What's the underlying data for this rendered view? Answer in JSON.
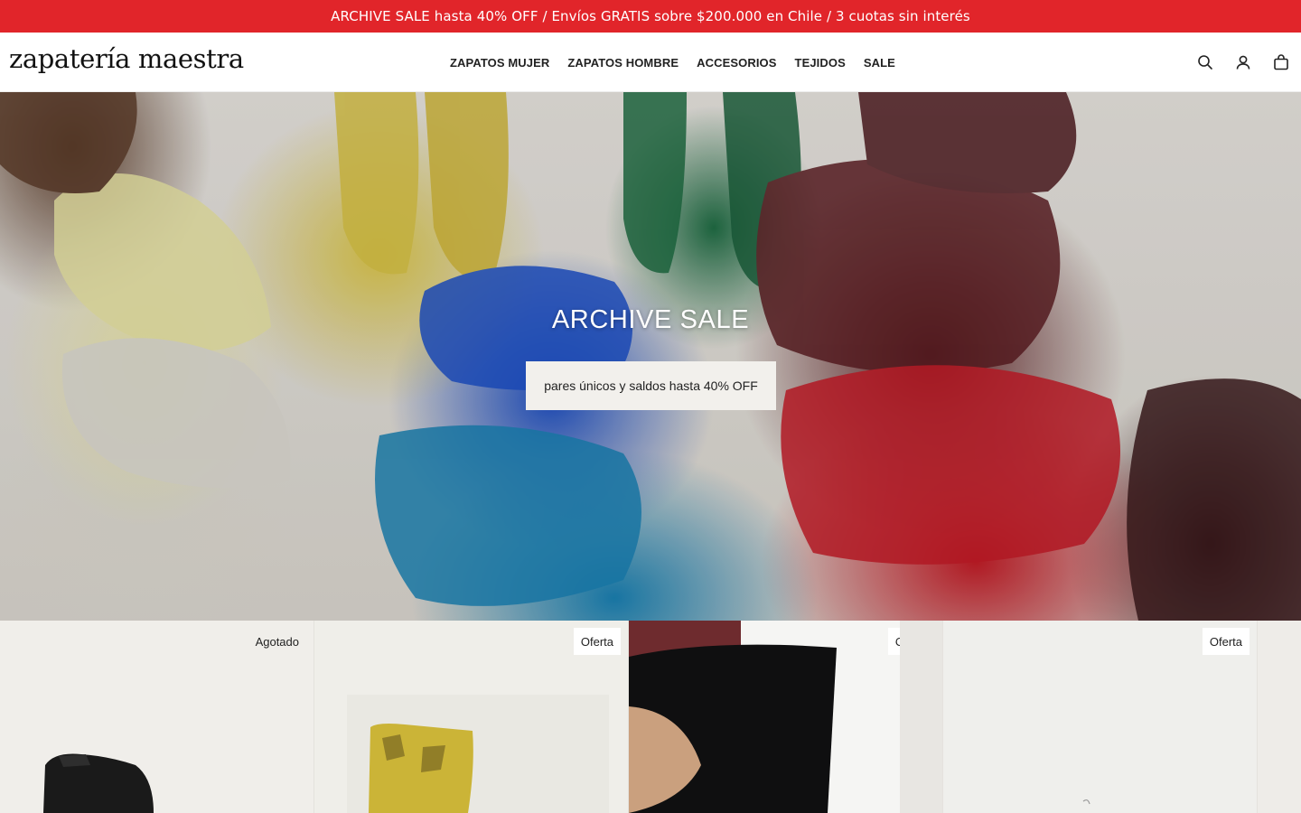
{
  "announcement": {
    "text": "ARCHIVE SALE hasta 40% OFF / Envíos GRATIS sobre $200.000 en Chile / 3 cuotas sin interés",
    "background": "#e1252a"
  },
  "header": {
    "logo": "zapatería maestra",
    "nav": [
      {
        "label": "ZAPATOS MUJER"
      },
      {
        "label": "ZAPATOS HOMBRE"
      },
      {
        "label": "ACCESORIOS"
      },
      {
        "label": "TEJIDOS"
      },
      {
        "label": "SALE"
      }
    ],
    "icons": [
      "search-icon",
      "account-icon",
      "cart-icon"
    ]
  },
  "hero": {
    "title": "ARCHIVE SALE",
    "button": "pares únicos y saldos hasta 40% OFF"
  },
  "products": [
    {
      "badge": "Agotado"
    },
    {
      "badge": "Oferta"
    },
    {
      "badge": "Oferta"
    },
    {
      "badge": "Oferta"
    }
  ]
}
